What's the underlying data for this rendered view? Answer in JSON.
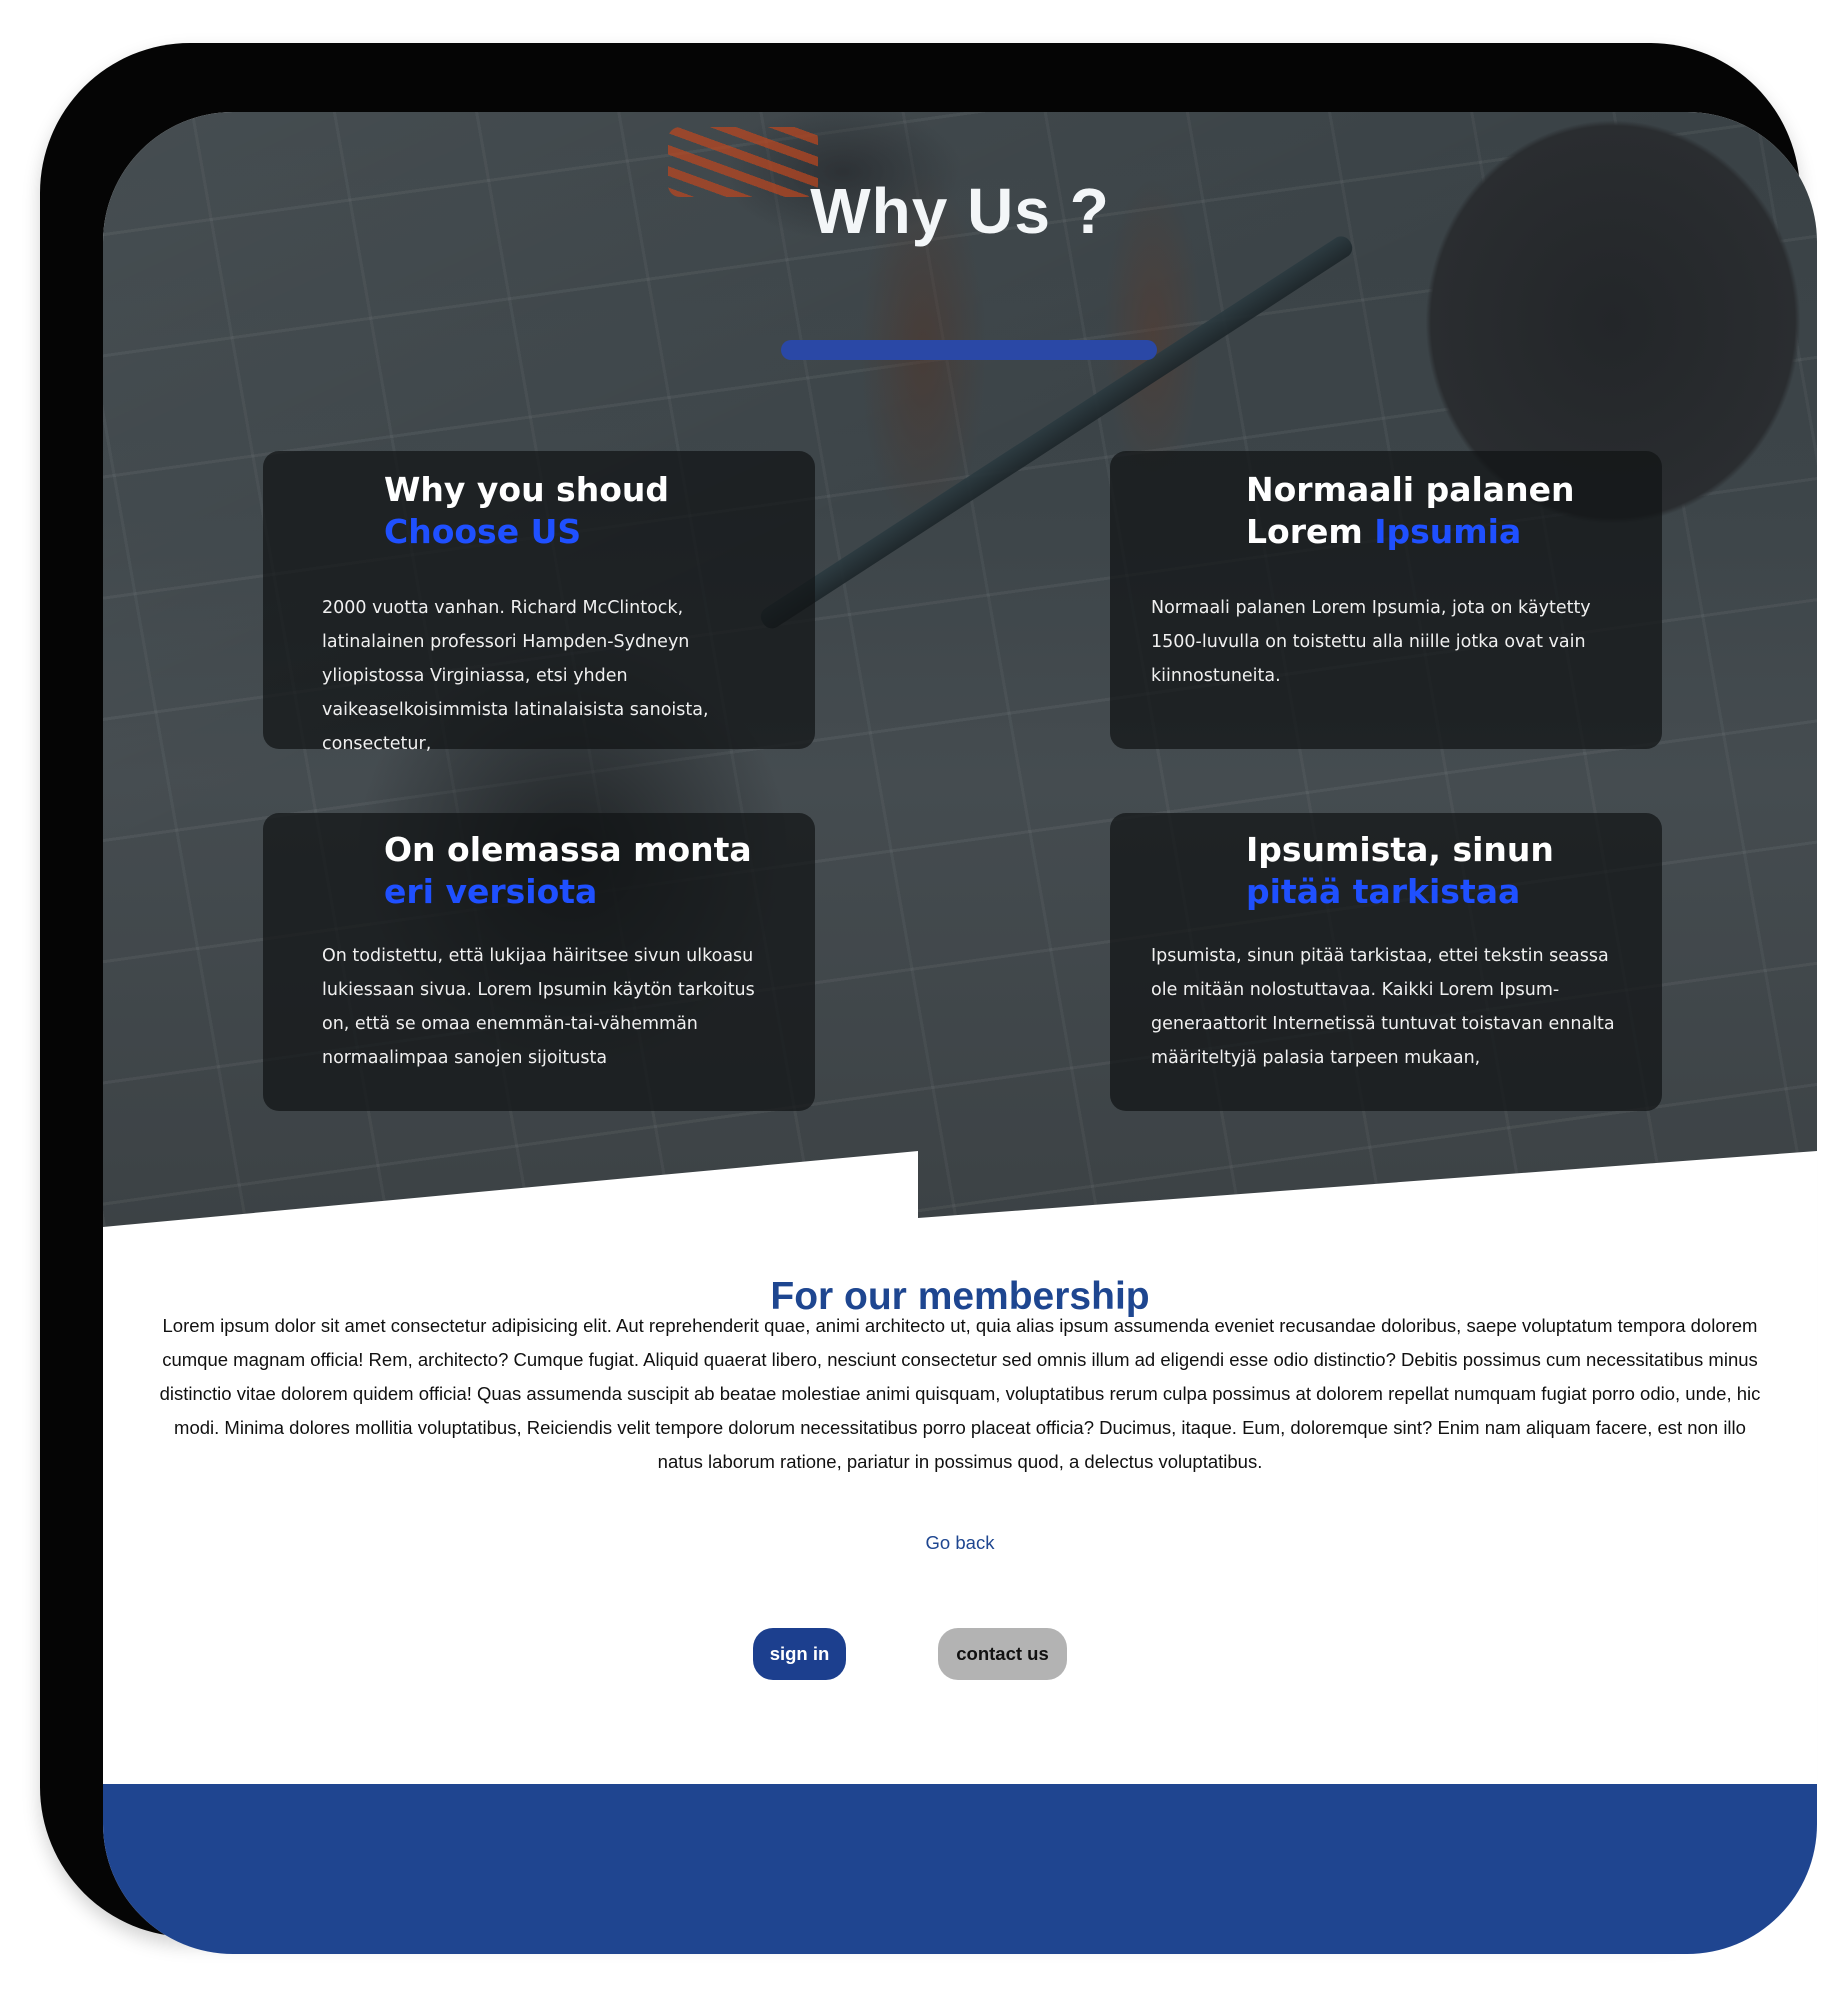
{
  "hero": {
    "title": "Why Us ?",
    "cards": [
      {
        "heading_line1": "Why you shoud",
        "heading_accent": "Choose US",
        "text": "2000 vuotta vanhan. Richard McClintock, latinalainen professori Hampden-Sydneyn yliopistossa Virginiassa, etsi yhden vaikeaselkoisimmista latinalaisista sanoista, consectetur,"
      },
      {
        "heading_line1": "Normaali palanen",
        "heading_line2_plain": "Lorem ",
        "heading_accent": "Ipsumia",
        "text": "Normaali palanen Lorem Ipsumia, jota on käytetty 1500-luvulla on toistettu alla niille jotka ovat vain kiinnostuneita."
      },
      {
        "heading_line1": "On olemassa monta",
        "heading_accent": "eri versiota",
        "text": "On todistettu, että lukijaa häiritsee sivun ulkoasu lukiessaan sivua. Lorem Ipsumin käytön tarkoitus on, että se omaa enemmän-tai-vähemmän normaalimpaa sanojen sijoitusta"
      },
      {
        "heading_line1": "Ipsumista, sinun",
        "heading_accent": "pitää tarkistaa",
        "text": "Ipsumista, sinun pitää tarkistaa, ettei tekstin seassa ole mitään nolostuttavaa. Kaikki Lorem Ipsum-generaattorit Internetissä tuntuvat toistavan ennalta määriteltyjä palasia tarpeen mukaan,"
      }
    ]
  },
  "membership": {
    "title": "For our membership",
    "text": "Lorem ipsum dolor sit amet consectetur adipisicing elit. Aut reprehenderit quae, animi architecto ut, quia alias ipsum assumenda eveniet recusandae doloribus, saepe voluptatum tempora dolorem cumque magnam officia! Rem, architecto? Cumque fugiat. Aliquid quaerat libero, nesciunt consectetur sed omnis illum ad eligendi esse odio distinctio? Debitis possimus cum necessitatibus minus distinctio vitae dolorem quidem officia! Quas assumenda suscipit ab beatae molestiae animi quisquam, voluptatibus rerum culpa possimus at dolorem repellat numquam fugiat porro odio, unde, hic modi. Minima dolores mollitia voluptatibus, Reiciendis velit tempore dolorum necessitatibus porro placeat officia? Ducimus, itaque. Eum, doloremque sint? Enim nam aliquam facere, est non illo natus laborum ratione, pariatur in possimus quod, a delectus voluptatibus.",
    "go_back": "Go back",
    "sign_in": "sign in",
    "contact_us": "contact us"
  },
  "colors": {
    "accent_blue": "#1f50ff",
    "brand_navy": "#1f4590",
    "underline_blue": "#2a48a6",
    "button_grey": "#b3b3b3"
  }
}
